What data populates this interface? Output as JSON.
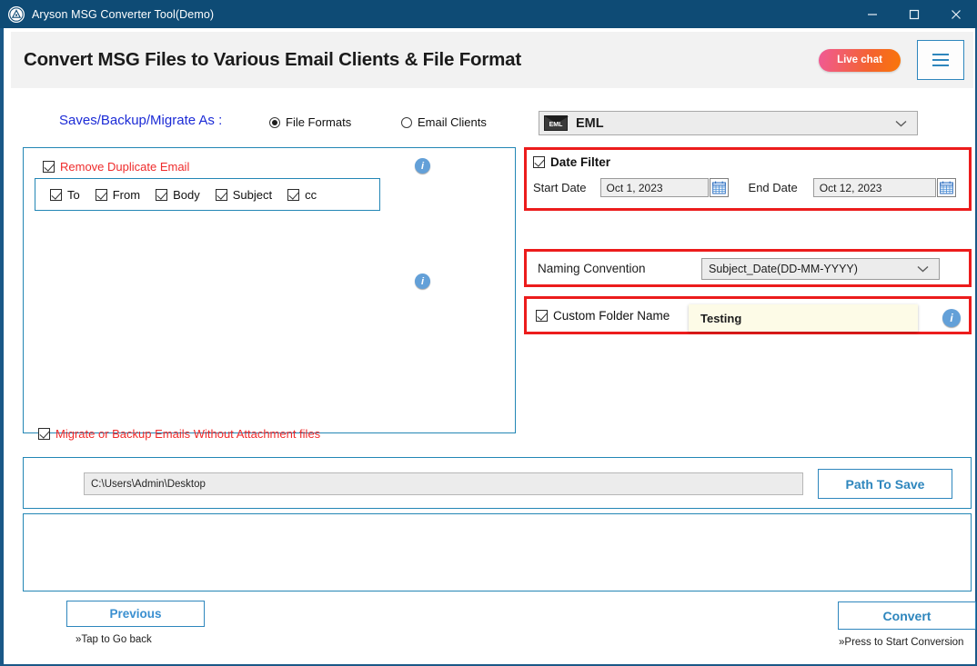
{
  "window": {
    "title": "Aryson MSG Converter Tool(Demo)",
    "logo_icon": "aryson-logo-icon",
    "minimize_icon": "minimize-icon",
    "maximize_icon": "maximize-icon",
    "close_icon": "close-icon"
  },
  "header": {
    "title": "Convert MSG Files to Various Email Clients & File Format",
    "live_chat_label": "Live chat",
    "menu_icon": "hamburger-menu-icon",
    "accent_color": "#2e86bd",
    "live_chat_gradient_from": "#f05a96",
    "live_chat_gradient_to": "#f97608"
  },
  "mode": {
    "label": "Saves/Backup/Migrate As :",
    "options": [
      {
        "label": "File Formats",
        "selected": true
      },
      {
        "label": "Email Clients",
        "selected": false
      }
    ],
    "format_select": {
      "value": "EML",
      "badge_text": "EML",
      "caret_icon": "chevron-down-icon"
    }
  },
  "left_panel": {
    "remove_duplicate": {
      "label": "Remove Duplicate Email",
      "checked": true,
      "color": "#ef2b2b",
      "info_icon": "info-icon"
    },
    "duplicate_fields": [
      {
        "label": "To",
        "checked": true
      },
      {
        "label": "From",
        "checked": true
      },
      {
        "label": "Body",
        "checked": true
      },
      {
        "label": "Subject",
        "checked": true
      },
      {
        "label": "cc",
        "checked": true
      }
    ],
    "without_attachment": {
      "label": "Migrate or Backup Emails Without Attachment files",
      "checked": true,
      "color": "#ef2b2b",
      "info_icon": "info-icon"
    }
  },
  "date_filter": {
    "label": "Date Filter",
    "checked": true,
    "highlight_color": "#ec1c1c",
    "start_label": "Start Date",
    "start_value": "Oct 1, 2023",
    "end_label": "End Date",
    "end_value": "Oct 12, 2023",
    "calendar_icon": "calendar-icon"
  },
  "naming_convention": {
    "label": "Naming Convention",
    "value": "Subject_Date(DD-MM-YYYY)",
    "caret_icon": "chevron-down-icon",
    "highlight_color": "#ec1c1c"
  },
  "custom_folder": {
    "label": "Custom Folder Name",
    "checked": true,
    "value": "Testing",
    "info_icon": "info-icon",
    "highlight_color": "#ec1c1c"
  },
  "path": {
    "value": "C:\\Users\\Admin\\Desktop",
    "button_label": "Path To Save"
  },
  "footer": {
    "previous_label": "Previous",
    "previous_hint": "»Tap to Go back",
    "convert_label": "Convert",
    "convert_hint": "»Press to Start Conversion"
  }
}
